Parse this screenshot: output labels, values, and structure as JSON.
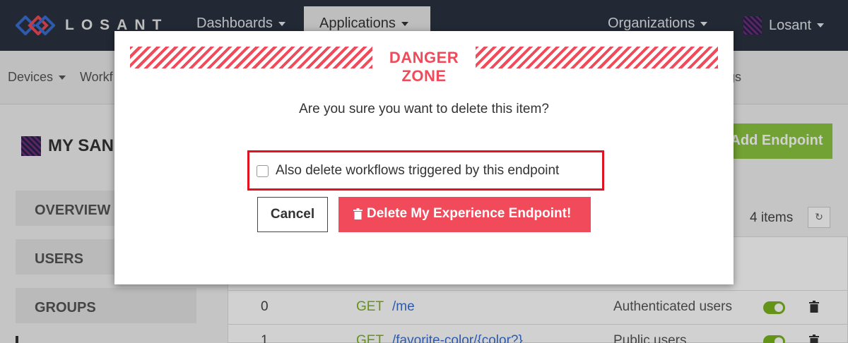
{
  "colors": {
    "nav_bg": "#2a3341",
    "danger": "#f14a5a",
    "success": "#8cc63f",
    "highlight": "#e0121f",
    "link": "#3a6ed1"
  },
  "topnav": {
    "logo_text": "LOSANT",
    "dashboards": "Dashboards",
    "applications": "Applications",
    "organizations": "Organizations",
    "user": "Losant"
  },
  "subnav": {
    "devices": "Devices",
    "workflows": "Workf",
    "right_cut": "gs"
  },
  "page": {
    "app_title": "MY SANDB",
    "sidebar": [
      "OVERVIEW",
      "USERS",
      "GROUPS"
    ],
    "add_endpoint": "Add Endpoint",
    "items_count": "4 items",
    "rows": [
      {
        "num": "0",
        "method": "GET",
        "path": "/me",
        "access": "Authenticated users"
      },
      {
        "num": "1",
        "method": "GET",
        "path": "/favorite-color/{color?}",
        "access": "Public users"
      }
    ]
  },
  "modal": {
    "danger_label": "DANGER ZONE",
    "question": "Are you sure you want to delete this item?",
    "checkbox_label": "Also delete workflows triggered by this endpoint",
    "checkbox_checked": false,
    "cancel_label": "Cancel",
    "delete_label": "Delete My Experience Endpoint!"
  },
  "icons": [
    "logo-icon",
    "caret-down-icon",
    "avatar-icon",
    "refresh-icon",
    "trash-icon",
    "toggle-icon"
  ]
}
